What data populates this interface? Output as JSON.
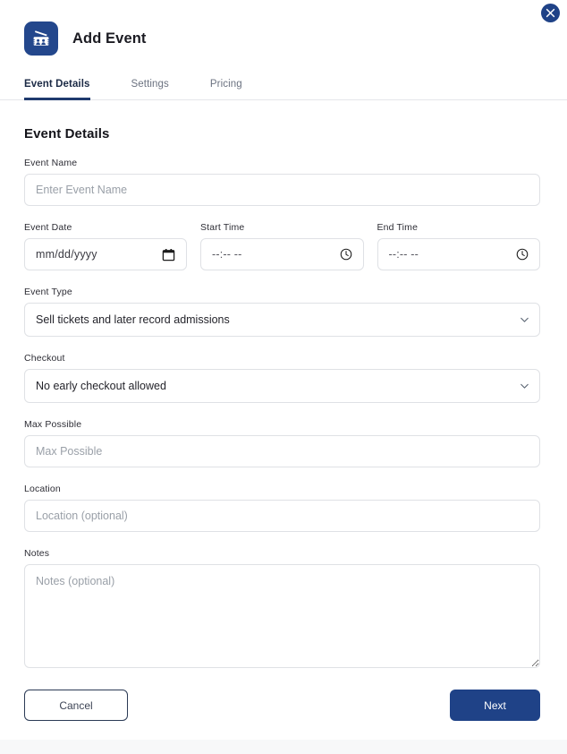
{
  "window": {
    "title": "Add Event",
    "app_icon": "ticket-admission-icon",
    "close_icon": "close-icon",
    "brand_color": "#1f4287",
    "icon_bg_color": "#23478c"
  },
  "tabs": [
    {
      "id": "event-details",
      "label": "Event Details",
      "active": true
    },
    {
      "id": "settings",
      "label": "Settings",
      "active": false
    },
    {
      "id": "pricing",
      "label": "Pricing",
      "active": false
    }
  ],
  "form": {
    "section_title": "Event Details",
    "event_name": {
      "label": "Event Name",
      "placeholder": "Enter Event Name",
      "value": ""
    },
    "event_date": {
      "label": "Event Date",
      "placeholder": "mm/dd/yyyy",
      "value": "",
      "icon": "calendar-icon"
    },
    "start_time": {
      "label": "Start Time",
      "placeholder": "--:-- --",
      "value": "",
      "icon": "clock-icon"
    },
    "end_time": {
      "label": "End Time",
      "placeholder": "--:-- --",
      "value": "",
      "icon": "clock-icon"
    },
    "event_type": {
      "label": "Event Type",
      "selected": "Sell tickets and later record admissions",
      "icon": "chevron-down-icon"
    },
    "checkout": {
      "label": "Checkout",
      "selected": "No early checkout allowed",
      "icon": "chevron-down-icon"
    },
    "max_possible": {
      "label": "Max Possible",
      "placeholder": "Max Possible",
      "value": ""
    },
    "location": {
      "label": "Location",
      "placeholder": "Location (optional)",
      "value": ""
    },
    "notes": {
      "label": "Notes",
      "placeholder": "Notes (optional)",
      "value": ""
    }
  },
  "actions": {
    "cancel_label": "Cancel",
    "next_label": "Next"
  }
}
